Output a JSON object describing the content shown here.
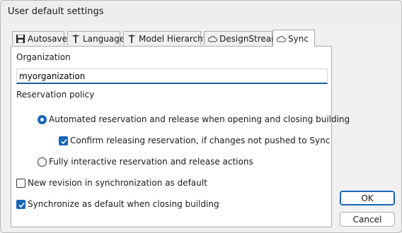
{
  "window": {
    "title": "User default settings"
  },
  "tabs": [
    {
      "label": "Autosave",
      "icon": "floppy-disk-icon"
    },
    {
      "label": "Language",
      "icon": "pin-tool-icon"
    },
    {
      "label": "Model Hierarchy",
      "icon": "pin-tool-icon"
    },
    {
      "label": "DesignStream",
      "icon": "cloud-icon"
    },
    {
      "label": "Sync",
      "icon": "cloud-icon",
      "active": true
    }
  ],
  "sync": {
    "organization_label": "Organization",
    "organization_value": "myorganization",
    "reservation_policy_label": "Reservation policy",
    "option_automated": "Automated reservation and release when opening and closing building",
    "option_automated_selected": true,
    "confirm_releasing": "Confirm releasing reservation, if changes not pushed to Sync",
    "confirm_releasing_checked": true,
    "option_interactive": "Fully interactive reservation and release actions",
    "option_interactive_selected": false,
    "new_revision": "New revision in synchronization as default",
    "new_revision_checked": false,
    "sync_on_close": "Synchronize as default when closing building",
    "sync_on_close_checked": true
  },
  "buttons": {
    "ok": "OK",
    "cancel": "Cancel"
  },
  "colors": {
    "accent": "#1865b8",
    "input_underline": "#1e5f9f"
  }
}
